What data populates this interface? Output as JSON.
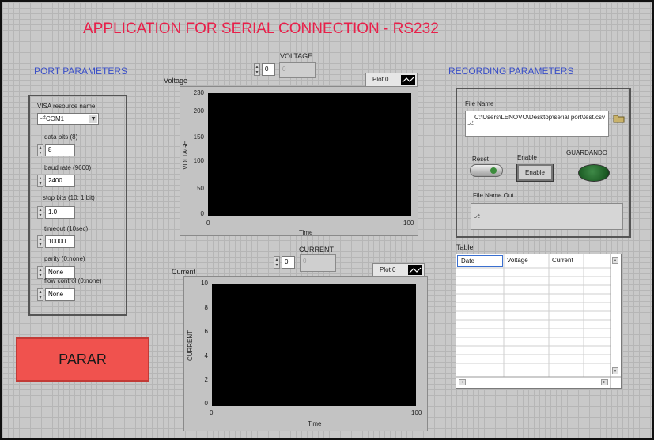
{
  "app": {
    "title": "APPLICATION FOR SERIAL CONNECTION - RS232"
  },
  "port": {
    "section_title": "PORT PARAMETERS",
    "visa_label": "VISA resource name",
    "visa_value": "COM1",
    "data_bits_label": "data bits (8)",
    "data_bits_value": "8",
    "baud_label": "baud rate (9600)",
    "baud_value": "2400",
    "stop_label": "stop bits (10: 1 bit)",
    "stop_value": "1.0",
    "timeout_label": "timeout (10sec)",
    "timeout_value": "10000",
    "parity_label": "parity (0:none)",
    "parity_value": "None",
    "flow_label": "flow control (0:none)",
    "flow_value": "None"
  },
  "stop_button": {
    "label": "PARAR"
  },
  "voltage": {
    "indicator_label": "VOLTAGE",
    "spin_value": "0",
    "display_value": "0",
    "graph_label": "Voltage",
    "legend": "Plot 0",
    "ylabel": "VOLTAGE",
    "xlabel": "Time",
    "yticks": [
      "230",
      "200",
      "150",
      "100",
      "50",
      "0"
    ],
    "xticks": [
      "0",
      "100"
    ]
  },
  "current": {
    "indicator_label": "CURRENT",
    "spin_value": "0",
    "display_value": "0",
    "graph_label": "Current",
    "legend": "Plot 0",
    "ylabel": "CURRENT",
    "xlabel": "Time",
    "yticks": [
      "10",
      "8",
      "6",
      "4",
      "2",
      "0"
    ],
    "xticks": [
      "0",
      "100"
    ]
  },
  "recording": {
    "section_title": "RECORDING PARAMETERS",
    "file_name_label": "File Name",
    "file_name_value": "C:\\Users\\LENOVO\\Desktop\\serial port\\test.csv",
    "reset_label": "Reset",
    "enable_label": "Enable",
    "enable_button": "Enable",
    "guardando_label": "GUARDANDO",
    "file_out_label": "File Name Out",
    "file_out_value": ""
  },
  "table": {
    "label": "Table",
    "columns": [
      "Date",
      "Voltage",
      "Current"
    ]
  },
  "colors": {
    "title": "#e8204a",
    "section": "#3a4fc7",
    "stop": "#f0524e",
    "led": "#1c5c24"
  }
}
